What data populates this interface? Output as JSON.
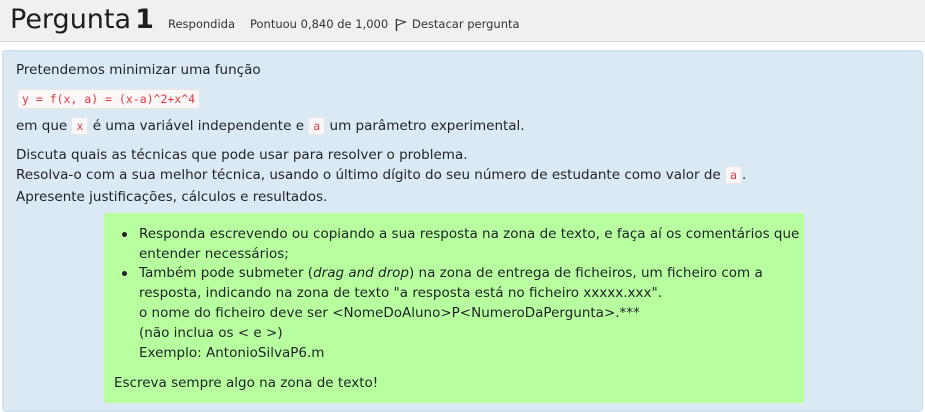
{
  "question": {
    "title_prefix": "Pergunta",
    "number": "1",
    "status": "Respondida",
    "grade": "Pontuou 0,840 de 1,000",
    "flag_label": "Destacar pergunta"
  },
  "body": {
    "intro": "Pretendemos minimizar uma função",
    "formula": "y = f(x, a) = (x-a)^2+x^4",
    "line2_a": "em que",
    "var_x": "x",
    "line2_b": "é uma variável independente e",
    "var_a": "a",
    "line2_c": "um parâmetro experimental.",
    "line3": "Discuta quais as técnicas que pode usar para resolver o problema.",
    "line4_a": "Resolva-o com a sua melhor técnica, usando o último dígito do seu número de estudante como valor de",
    "line4_var": "a",
    "line4_b": ".",
    "line5": "Apresente justificações, cálculos e resultados."
  },
  "instructions": {
    "bullet1_line1": "Responda escrevendo ou copiando a sua resposta na zona de texto, e faça aí os comentários que",
    "bullet1_line2": "entender necessários;",
    "bullet2_line1_a": "Também pode submeter (",
    "bullet2_line1_em": "drag and drop",
    "bullet2_line1_b": ") na zona de entrega de ficheiros, um ficheiro com a",
    "bullet2_line2": "resposta, indicando na zona de texto \"a resposta está no ficheiro xxxxx.xxx\".",
    "bullet2_line3": "o nome do ficheiro deve ser <NomeDoAluno>P<NumeroDaPergunta>.***",
    "bullet2_line4": "(não inclua os < e >)",
    "bullet2_line5": "Exemplo: AntonioSilvaP6.m",
    "footer": "Escreva sempre algo na zona de texto!"
  },
  "icons": {
    "flag": "flag-icon"
  },
  "colors": {
    "content_bg": "#dbe9f5",
    "instructions_bg": "#b7ff9f",
    "code": "#d63b45"
  }
}
